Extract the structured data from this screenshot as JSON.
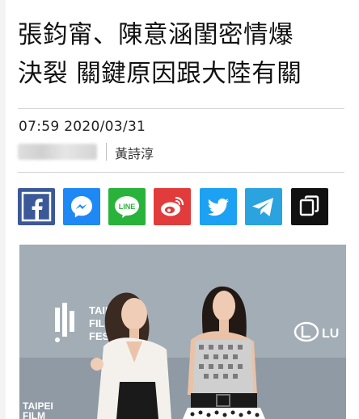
{
  "article": {
    "title_line1": "張鈞甯、陳意涵閨密情爆",
    "title_line2": "決裂 關鍵原因跟大陸有關",
    "datetime": "07:59  2020/03/31",
    "author": "黃詩淳"
  },
  "share_buttons": [
    {
      "name": "facebook",
      "color": "#3b5998",
      "icon": "facebook-icon"
    },
    {
      "name": "messenger",
      "color": "#1e88f5",
      "icon": "messenger-icon"
    },
    {
      "name": "line",
      "color": "#29b33a",
      "icon": "line-icon",
      "label": "LINE"
    },
    {
      "name": "weibo",
      "color": "#e23b3b",
      "icon": "weibo-icon"
    },
    {
      "name": "twitter",
      "color": "#1da1f2",
      "icon": "twitter-icon"
    },
    {
      "name": "telegram",
      "color": "#2aa3df",
      "icon": "telegram-icon"
    },
    {
      "name": "copy-link",
      "color": "#111111",
      "icon": "copy-icon"
    }
  ],
  "photo": {
    "backdrop_text": {
      "line1": "TAIPEI",
      "line2": "FILM",
      "line3": "FEST",
      "bottom1": "TAIPEI",
      "bottom2": "FILM",
      "sponsor": "LU"
    }
  }
}
